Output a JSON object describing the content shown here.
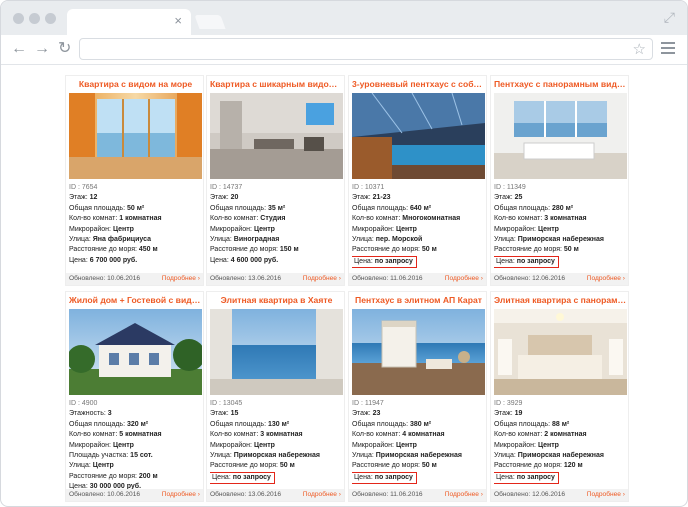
{
  "browser": {
    "tab_close": "×",
    "nav_back": "←",
    "nav_forward": "→",
    "nav_reload": "↻",
    "star": "☆",
    "expand": "⤢"
  },
  "labels": {
    "id": "ID : ",
    "floor": "Этаж: ",
    "floors": "Этажность: ",
    "area": "Общая площадь: ",
    "rooms": "Кол-во комнат: ",
    "district": "Микрорайон: ",
    "plot": "Площадь участка: ",
    "street": "Улица: ",
    "sea": "Расстояние до моря: ",
    "price": "Цена: ",
    "updated": "Обновлено: ",
    "more": "Подробнее ›"
  },
  "cards": [
    {
      "title": "Квартира с видом на море",
      "id": "7654",
      "floor": "12",
      "area": "50 м²",
      "rooms": "1 комнатная",
      "district": "Центр",
      "street": "Яна фабрициуса",
      "sea": "450 м",
      "price": "6 700 000 руб.",
      "price_highlight": false,
      "updated": "10.06.2016"
    },
    {
      "title": "Квартира с шикарным видом на...",
      "id": "14737",
      "floor": "20",
      "area": "35 м²",
      "rooms": "Студия",
      "district": "Центр",
      "street": "Виноградная",
      "sea": "150 м",
      "price": "4 600 000 руб.",
      "price_highlight": false,
      "updated": "13.06.2016"
    },
    {
      "title": "3-уровневый пентхаус с собств...",
      "id": "10371",
      "floor": "21-23",
      "area": "640 м²",
      "rooms": "Многокомнатная",
      "district": "Центр",
      "street": "пер. Морской",
      "sea": "50 м",
      "price": "по запросу",
      "price_highlight": true,
      "updated": "11.06.2016"
    },
    {
      "title": "Пентхаус с панорамным видом",
      "id": "11349",
      "floor": "25",
      "area": "280 м²",
      "rooms": "3 комнатная",
      "district": "Центр",
      "street": "Приморская набережная",
      "sea": "50 м",
      "price": "по запросу",
      "price_highlight": true,
      "updated": "12.06.2016"
    },
    {
      "title": "Жилой дом + Гостевой с видом ...",
      "id": "4900",
      "floors": "3",
      "area": "320 м²",
      "rooms": "5 комнатная",
      "district": "Центр",
      "plot": "15 сот.",
      "street": "Центр",
      "sea": "200 м",
      "price": "30 000 000 руб.",
      "price_highlight": false,
      "updated": "10.06.2016"
    },
    {
      "title": "Элитная квартира в Хаяте",
      "id": "13045",
      "floor": "15",
      "area": "130 м²",
      "rooms": "3 комнатная",
      "district": "Центр",
      "street": "Приморская набережная",
      "sea": "50 м",
      "price": "по запросу",
      "price_highlight": true,
      "updated": "13.06.2016"
    },
    {
      "title": "Пентхаус в элитном АП Карат",
      "id": "11947",
      "floor": "23",
      "area": "380 м²",
      "rooms": "4 комнатная",
      "district": "Центр",
      "street": "Приморская набережная",
      "sea": "50 м",
      "price": "по запросу",
      "price_highlight": true,
      "updated": "11.06.2016"
    },
    {
      "title": "Элитная квартира с панорамны...",
      "id": "3929",
      "floor": "19",
      "area": "88 м²",
      "rooms": "2 комнатная",
      "district": "Центр",
      "street": "Приморская набережная",
      "sea": "120 м",
      "price": "по запросу",
      "price_highlight": true,
      "updated": "12.06.2016"
    }
  ],
  "colors": {
    "accent": "#ee5a24",
    "highlight": "#e32619"
  }
}
